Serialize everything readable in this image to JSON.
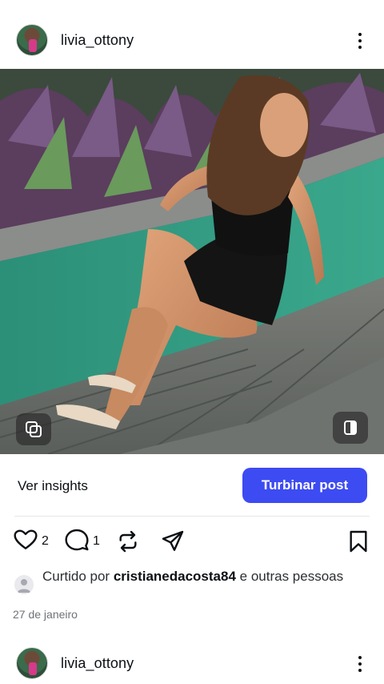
{
  "post": {
    "username": "livia_ottony",
    "avatar_icon": "profile-photo-avatar",
    "menu_icon": "more-vertical-icon"
  },
  "media": {
    "carousel_icon": "multiple-photos-icon",
    "toggle_icon": "switch-view-icon"
  },
  "insights": {
    "view_label": "Ver insights",
    "boost_label": "Turbinar post",
    "boost_color": "#3d4bf2"
  },
  "actions": {
    "like_icon": "heart-icon",
    "like_count": "2",
    "comment_icon": "comment-icon",
    "comment_count": "1",
    "repost_icon": "repost-icon",
    "share_icon": "send-icon",
    "save_icon": "bookmark-icon"
  },
  "likes": {
    "prefix": "Curtido por ",
    "user": "cristianedacosta84",
    "suffix": " e outras pessoas"
  },
  "date": "27 de janeiro",
  "next_post": {
    "username": "livia_ottony"
  }
}
